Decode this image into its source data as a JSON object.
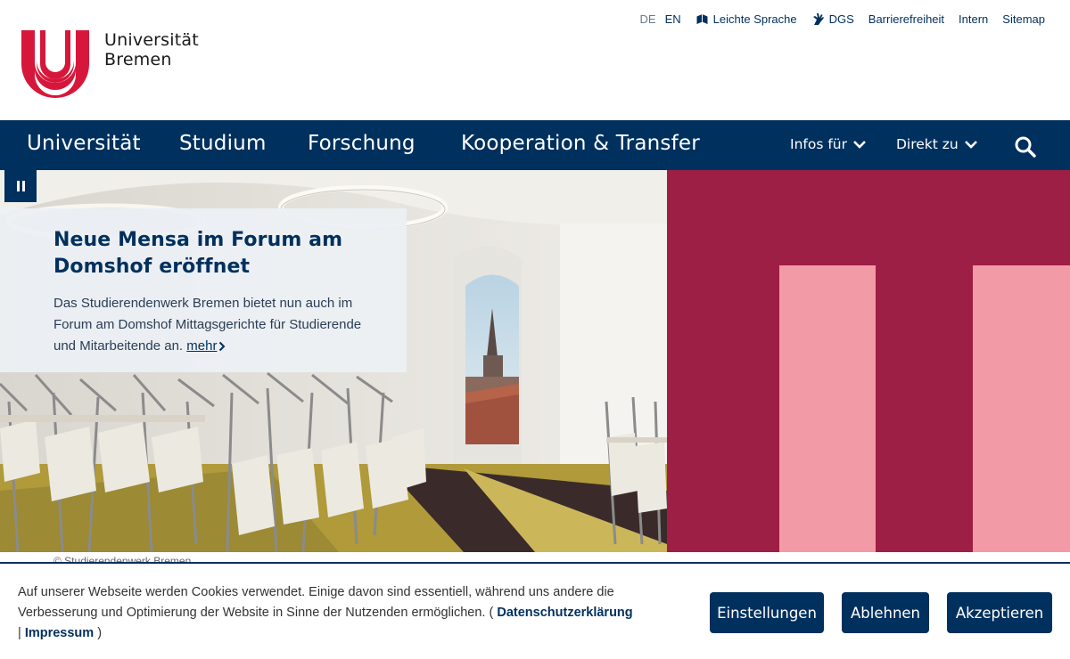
{
  "logo": {
    "line1": "Universität",
    "line2": "Bremen"
  },
  "meta_nav": {
    "lang_de": "DE",
    "lang_en": "EN",
    "leichte_sprache": "Leichte Sprache",
    "dgs": "DGS",
    "barrierefreiheit": "Barrierefreiheit",
    "intern": "Intern",
    "sitemap": "Sitemap"
  },
  "main_nav": {
    "items": [
      "Universität",
      "Studium",
      "Forschung",
      "Kooperation & Transfer"
    ],
    "infos_fuer": "Infos für",
    "direkt_zu": "Direkt zu"
  },
  "hero": {
    "title": "Neue Mensa im Forum am Domshof eröffnet",
    "text": "Das Studierendenwerk Bremen bietet nun auch im Forum am Domshof Mittagsgerichte für Studierende und Mitarbeitende an.",
    "more": "mehr",
    "credit": "© Studierendenwerk Bremen"
  },
  "cookie": {
    "text": "Auf unserer Webseite werden Cookies verwendet. Einige davon sind essentiell, während uns andere die Verbesserung und Optimierung der Website in Sinne der Nutzenden ermöglichen. (",
    "privacy": "Datenschutzerklärung",
    "separator": "|",
    "imprint": "Impressum",
    "close_paren": ")",
    "btn_settings": "Einstellungen",
    "btn_reject": "Ablehnen",
    "btn_accept": "Akzeptieren"
  },
  "colors": {
    "brand_blue": "#00305e",
    "brand_red": "#d6173b",
    "deco_dark": "#9e1f45",
    "deco_light": "#f29ba6"
  }
}
